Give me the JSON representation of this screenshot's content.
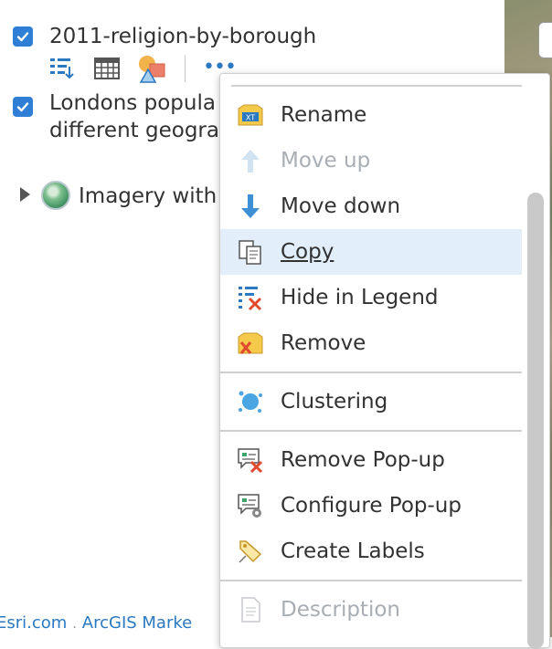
{
  "layers": [
    {
      "title": "2011-religion-by-borough",
      "checked": true
    },
    {
      "title_line1": "Londons popula",
      "title_line2": "different geogra",
      "checked": true
    },
    {
      "title": "Imagery with"
    }
  ],
  "toolbar": {
    "icons": [
      "show-legend-icon",
      "show-table-icon",
      "change-style-icon",
      "more-options-icon"
    ],
    "more_label": "•••"
  },
  "footer": {
    "link1": "Esri.com",
    "link2": "ArcGIS Marke"
  },
  "context_menu": {
    "items": [
      {
        "label": "Rename",
        "icon": "rename-icon",
        "disabled": false
      },
      {
        "label": "Move up",
        "icon": "arrow-up-icon",
        "disabled": true
      },
      {
        "label": "Move down",
        "icon": "arrow-down-icon",
        "disabled": false
      },
      {
        "label": "Copy",
        "icon": "copy-icon",
        "disabled": false,
        "hovered": true
      },
      {
        "label": "Hide in Legend",
        "icon": "hide-legend-icon",
        "disabled": false
      },
      {
        "label": "Remove",
        "icon": "remove-icon",
        "disabled": false
      },
      {
        "label": "Clustering",
        "icon": "clustering-icon",
        "disabled": false
      },
      {
        "label": "Remove Pop-up",
        "icon": "remove-popup-icon",
        "disabled": false
      },
      {
        "label": "Configure Pop-up",
        "icon": "configure-popup-icon",
        "disabled": false
      },
      {
        "label": "Create Labels",
        "icon": "create-labels-icon",
        "disabled": false
      },
      {
        "label": "Description",
        "icon": "description-icon",
        "disabled": true
      }
    ]
  },
  "colors": {
    "accent": "#2f7fd6",
    "link": "#2b79c2",
    "hover_bg": "#e2eefa",
    "disabled_text": "#a8aeb4"
  }
}
